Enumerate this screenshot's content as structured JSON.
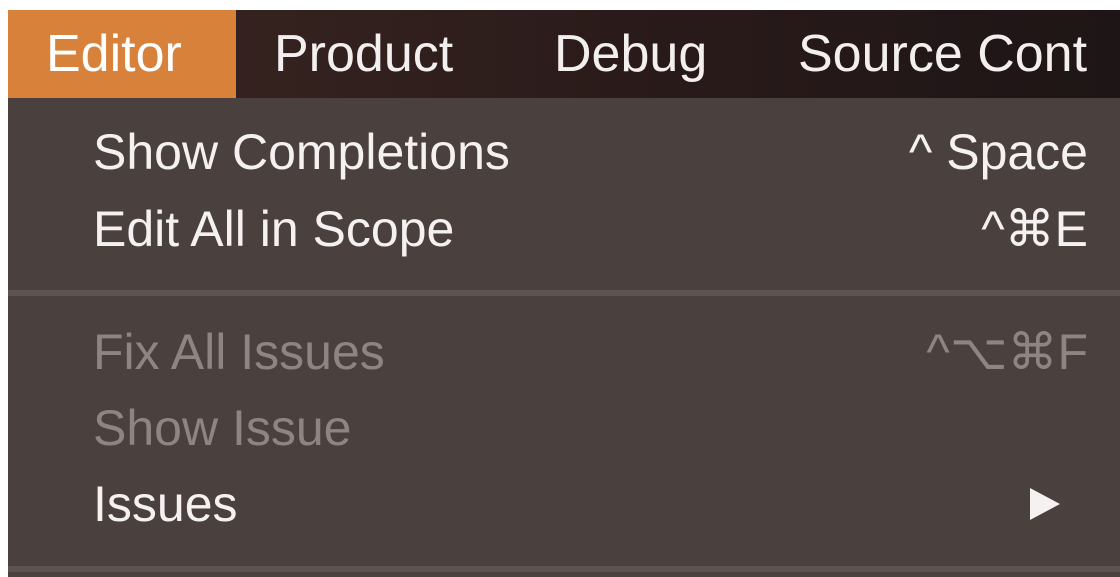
{
  "menubar": {
    "items": [
      {
        "label": "Editor"
      },
      {
        "label": "Product"
      },
      {
        "label": "Debug"
      },
      {
        "label": "Source Cont"
      }
    ],
    "active": "Editor",
    "active_color": "#d8813a"
  },
  "editor_menu": {
    "items": [
      {
        "label": "Show Completions",
        "shortcut": "^ Space",
        "enabled": true
      },
      {
        "label": "Edit All in Scope",
        "shortcut": "^⌘E",
        "enabled": true
      },
      {
        "label": "Fix All Issues",
        "shortcut": "^⌥⌘F",
        "enabled": false
      },
      {
        "label": "Show Issue",
        "shortcut": "",
        "enabled": false
      },
      {
        "label": "Issues",
        "shortcut": "",
        "enabled": true,
        "submenu_icon": "triangle-right-icon"
      }
    ]
  },
  "colors": {
    "menu_background": "#4a403e",
    "disabled_text": "#8e8583",
    "text": "#f4f1f0"
  }
}
